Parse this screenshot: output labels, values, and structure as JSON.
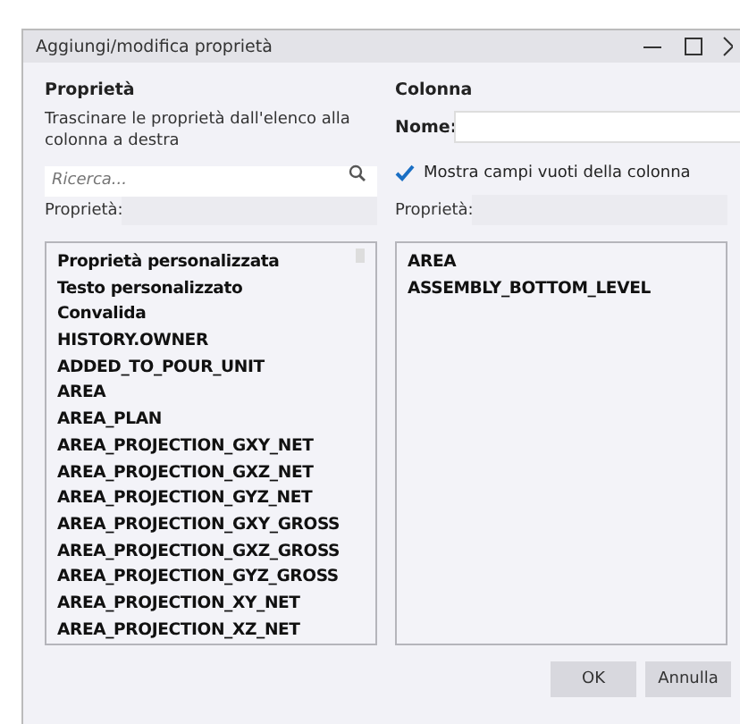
{
  "window": {
    "title": "Aggiungi/modifica proprietà"
  },
  "left": {
    "heading": "Proprietà",
    "instructions": "Trascinare le proprietà dall'elenco alla colonna a destra",
    "search": {
      "placeholder": "Ricerca..."
    },
    "property_label": "Proprietà:",
    "items": [
      "Proprietà personalizzata",
      "Testo personalizzato",
      "Convalida",
      "HISTORY.OWNER",
      "ADDED_TO_POUR_UNIT",
      "AREA",
      "AREA_PLAN",
      "AREA_PROJECTION_GXY_NET",
      "AREA_PROJECTION_GXZ_NET",
      "AREA_PROJECTION_GYZ_NET",
      "AREA_PROJECTION_GXY_GROSS",
      "AREA_PROJECTION_GXZ_GROSS",
      "AREA_PROJECTION_GYZ_GROSS",
      "AREA_PROJECTION_XY_NET",
      "AREA_PROJECTION_XZ_NET"
    ]
  },
  "right": {
    "heading": "Colonna",
    "name_label": "Nome:",
    "show_empty": {
      "label": "Mostra campi vuoti della colonna",
      "checked": true
    },
    "property_label": "Proprietà:",
    "items": [
      "AREA",
      "ASSEMBLY_BOTTOM_LEVEL"
    ]
  },
  "buttons": [
    "OK",
    "Annulla"
  ]
}
